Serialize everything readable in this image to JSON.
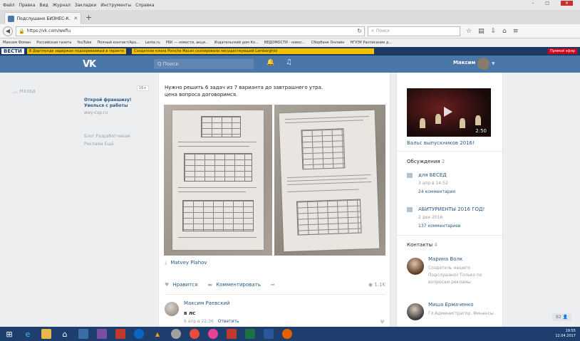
{
  "browser": {
    "menu": [
      "Файл",
      "Правка",
      "Вид",
      "Журнал",
      "Закладки",
      "Инструменты",
      "Справка"
    ],
    "tab_title": "Подслушано БИЗНЕС-К...",
    "url": "https://vk.com/wefiu",
    "search_placeholder": "Поиск",
    "bookmarks": [
      "Максим Фоман",
      "Российская газета",
      "YouTube",
      "Полный контакт/Арх...",
      "Lenta.ru",
      "РБК — новости, акци...",
      "Издательский дом Ко...",
      "ВЕДОМОСТИ - новос...",
      "Сбербанк Онлайн",
      "НГУЭУ Расписание д..."
    ]
  },
  "ticker": {
    "logo": "ВЕСТИ",
    "news1": "В Дортмунде задержан подозреваемый в теракте",
    "news2": "Создатели клона Porsche Macan скопировали несуществующий Lamborghini",
    "live": "Прямой эфир"
  },
  "vk": {
    "logo": "VK",
    "search_placeholder": "Q Поиск",
    "user_name": "Максим"
  },
  "sidebar": {
    "back": "Назад",
    "ad_title": "Открой франшизу! Уволься с работы",
    "ad_site": "way-cup.ru",
    "ad_badge": "16+",
    "links_line1": "Блог   Разработчикам",
    "links_line2": "Реклама   Ещё"
  },
  "post": {
    "text_line1": "Нужно решить 6 задач из 7 варианта до завтрашнего утра.",
    "text_line2": "цена вопроса договоримся.",
    "author": "Matvey Plahov",
    "like_label": "Нравится",
    "comment_label": "Комментировать",
    "views": "1.1K",
    "comment": {
      "name": "Максим Раевский",
      "text": "в лс",
      "date": "6 апр в 22:36",
      "reply": "Ответить"
    }
  },
  "right": {
    "video_duration": "2:50",
    "video_title": "Вальс выпускников 2016!",
    "discussions_title": "Обсуждения",
    "discussions_count": "2",
    "discussions": [
      {
        "title": "для БЕСЕД",
        "date": "3 апр в 14:52",
        "comments": "24 комментария"
      },
      {
        "title": "АБИТУРИЕНТЫ 2016 ГОД!",
        "date": "2 дек 2016",
        "comments": "137 комментариев"
      }
    ],
    "contacts_title": "Контакты",
    "contacts_count": "4",
    "contacts": [
      {
        "name": "Марина Волк",
        "role": "Создатель нашего Подслушано) Только по вопросам рекламы"
      },
      {
        "name": "Миша Ермаченко",
        "role": "Гл.Администратор. Финансы."
      }
    ]
  },
  "scroll_badge": "82",
  "taskbar": {
    "time": "19:55",
    "date": "12.04.2017"
  }
}
